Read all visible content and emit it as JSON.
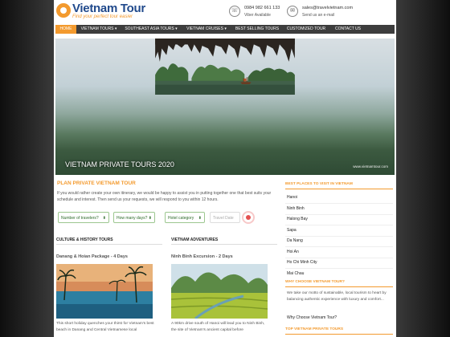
{
  "header": {
    "logo_title": "Vietnam Tour",
    "logo_tagline": "Find your perfect tour easier",
    "phone": "0984 982 661 133",
    "phone_sub": "Viber Available",
    "email": "sales@travelvietnam.com",
    "email_sub": "Send us an e-mail"
  },
  "nav": {
    "items": [
      {
        "label": "HOME",
        "active": true
      },
      {
        "label": "VIETNAM TOURS ▾"
      },
      {
        "label": "SOUTHEAST ASIA TOURS ▾"
      },
      {
        "label": "VIETNAM CRUISES ▾"
      },
      {
        "label": "BEST SELLING TOURS"
      },
      {
        "label": "CUSTOMIZED TOUR"
      },
      {
        "label": "CONTACT US"
      }
    ]
  },
  "hero": {
    "caption": "VIETNAM PRIVATE TOURS 2020",
    "watermark": "www.vietnamtour.com"
  },
  "plan": {
    "title": "PLAN PRIVATE VIETNAM TOUR",
    "text": "If you would rather create your own itinerary, we would be happy to assist you in putting together one that best suits your schedule and interest. Then send us your requests, we will respond to you within 12 hours.",
    "travelers_label": "Number of travelers?",
    "days_label": "How many days?",
    "hotel_label": "Hotel category",
    "date_placeholder": "Travel Date"
  },
  "columns": [
    {
      "heading": "CULTURE & HISTORY TOURS",
      "tour_title": "Danang & Hoian Package - 4 Days",
      "tour_desc": "This short holiday quenches your thirst for Vietnam's best beach in Danang and Central Vietnamese local"
    },
    {
      "heading": "VIETNAM ADVENTURES",
      "tour_title": "Ninh Binh Excursion - 2 Days",
      "tour_desc": "A 90km drive south of Hanoi will lead you to Ninh Binh, the site of Vietnam's ancient capital before"
    }
  ],
  "sidebar": {
    "places_heading": "BEST PLACES TO VISIT IN VIETNAM",
    "places": [
      "Hanoi",
      "Ninh Binh",
      "Halong Bay",
      "Sapa",
      "Da Nang",
      "Hoi An",
      "Ho Chi Minh City",
      "Mai Chau"
    ],
    "why_heading": "WHY CHOOSE VIETNAM TOUR?",
    "why_text": "We take our motto of sustainable, local tourism to heart by balancing authentic experience with luxury and comfort...",
    "why_link": "Why Choose Vietnam Tour?",
    "top_heading": "TOP VIETNAM PRIVATE TOURS"
  },
  "colors": {
    "accent": "#f39a2e",
    "nav_bg": "#3d3d3d",
    "logo_blue": "#214a8c"
  }
}
